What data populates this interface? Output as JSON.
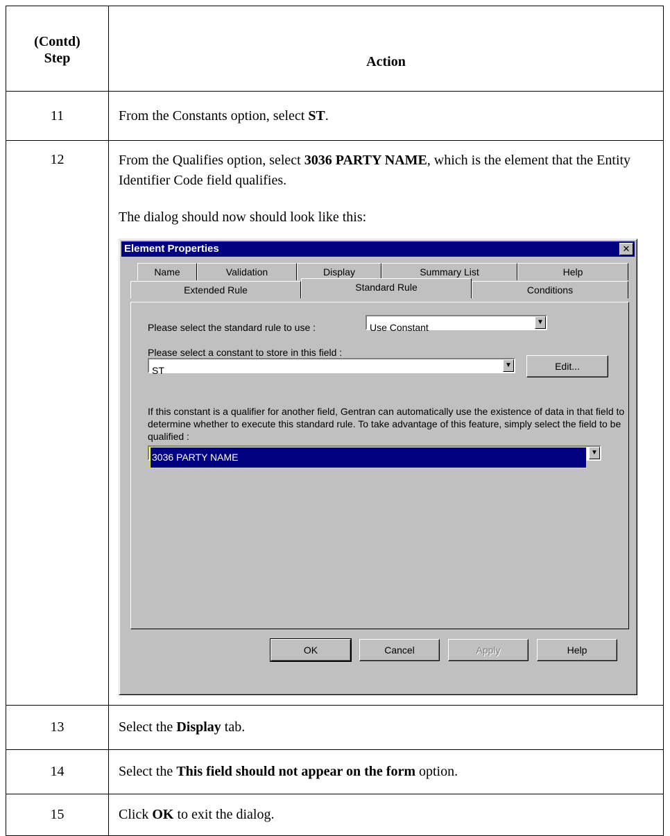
{
  "table": {
    "header_step": "(Contd)\nStep",
    "header_action": "Action"
  },
  "steps": [
    {
      "num": "11",
      "text_before": "From the Constants option, select ",
      "bold": "ST",
      "text_after": "."
    },
    {
      "num": "12",
      "text_before": "From the Qualifies option, select ",
      "bold": "3036 PARTY NAME",
      "text_after": ", which is the element that the Entity Identifier Code field qualifies.",
      "note": "The dialog should now should look like this:"
    },
    {
      "num": "13",
      "text_before": "Select the ",
      "bold": "Display",
      "text_after": " tab."
    },
    {
      "num": "14",
      "text_before": "Select the ",
      "bold": "This field should not appear on the form",
      "text_after": " option."
    },
    {
      "num": "15",
      "text_before": "Click ",
      "bold": "OK",
      "text_after": " to exit the dialog."
    }
  ],
  "dialog": {
    "title": "Element Properties",
    "close_glyph": "✕",
    "tabs_back": [
      "Name",
      "Validation",
      "Display",
      "Summary List",
      "Help"
    ],
    "tabs_front": [
      "Extended Rule",
      "Standard Rule",
      "Conditions"
    ],
    "active_tab": "Standard Rule",
    "rule_label": "Please select the standard rule to use :",
    "rule_value": "Use Constant",
    "constant_label": "Please select a constant to store in this field :",
    "constant_value": "ST",
    "edit_button": "Edit...",
    "qualifier_text": "If this constant is a qualifier for another field, Gentran can automatically use the existence of data in that field to determine whether to execute this standard rule. To take advantage of this feature, simply select the field to be qualified :",
    "qualifier_value": "3036 PARTY NAME",
    "buttons": {
      "ok": "OK",
      "cancel": "Cancel",
      "apply": "Apply",
      "help": "Help"
    },
    "colors": {
      "titlebar": "#000080",
      "face": "#c0c0c0"
    }
  }
}
